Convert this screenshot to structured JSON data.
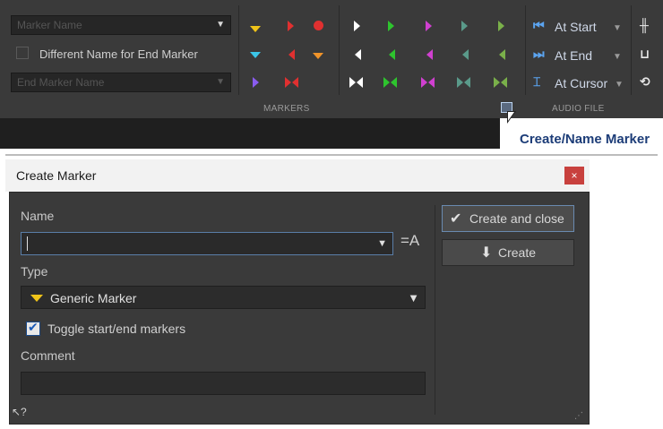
{
  "ribbon": {
    "marker_name_combo": "Marker Name",
    "different_name_label": "Different Name for End Marker",
    "end_marker_name_combo": "End Marker Name",
    "markers_group_label": "MARKERS",
    "audio_file_group_label": "AUDIO FILE",
    "at_start_label": "At Start",
    "at_end_label": "At End",
    "at_cursor_label": "At Cursor"
  },
  "tooltip": {
    "text": "Create/Name Marker"
  },
  "dialog": {
    "title": "Create Marker",
    "close_glyph": "×",
    "name_label": "Name",
    "name_value": "",
    "type_label": "Type",
    "type_value": "Generic Marker",
    "toggle_label": "Toggle start/end markers",
    "toggle_checked": true,
    "comment_label": "Comment",
    "comment_value": "",
    "create_and_close_label": "Create and close",
    "create_label": "Create"
  },
  "colors": {
    "ribbon_bg": "#3a3a3a",
    "dialog_bg": "#3a3a3a",
    "accent_blue": "#5ba4f0",
    "close_red": "#c8413e",
    "marker_yellow": "#f0c419",
    "marker_cyan": "#3bc6e8",
    "marker_purple": "#8a5cf0",
    "marker_red": "#e03030",
    "marker_orange": "#f0942a",
    "marker_white": "#ffffff",
    "marker_green": "#2ec42e",
    "marker_magenta": "#d040d0",
    "marker_teal": "#5a9a8a",
    "marker_olive": "#7ab04a"
  }
}
